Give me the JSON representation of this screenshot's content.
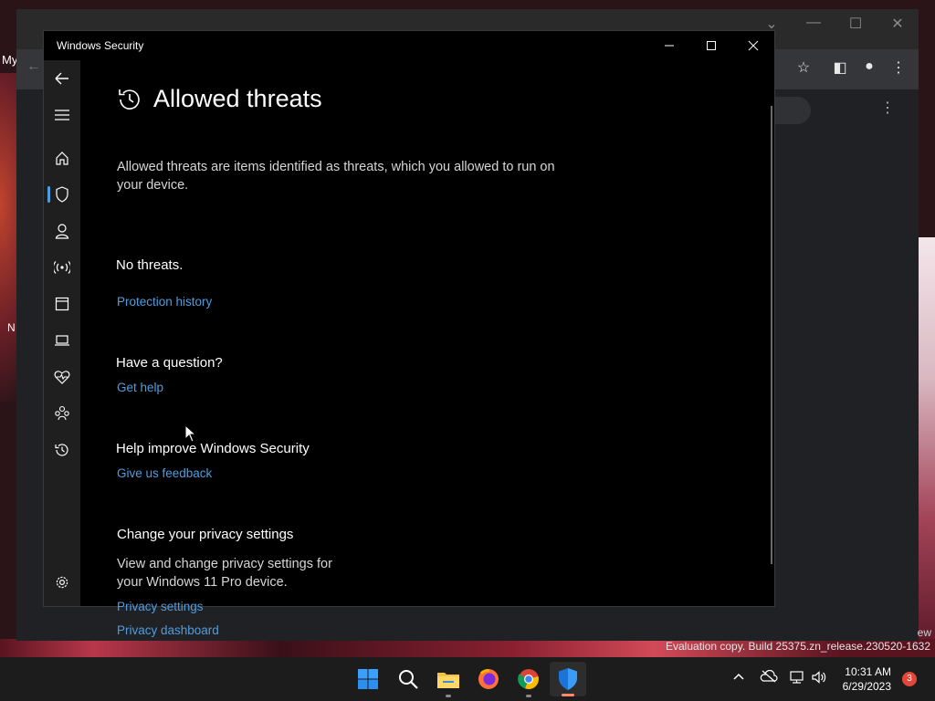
{
  "desktop": {
    "left_text_1": "My",
    "left_text_2": "N",
    "watermark": "Evaluation copy. Build 25375.zn_release.230520-1632",
    "watermark_fragment": "ew"
  },
  "window": {
    "title": "Windows Security"
  },
  "page": {
    "title": "Allowed threats",
    "description": "Allowed threats are items identified as threats, which you allowed to run on your device.",
    "status": "No threats.",
    "protection_history_link": "Protection history"
  },
  "question_section": {
    "heading": "Have a question?",
    "link": "Get help"
  },
  "improve_section": {
    "heading": "Help improve Windows Security",
    "link": "Give us feedback"
  },
  "privacy_section": {
    "heading": "Change your privacy settings",
    "description": "View and change privacy settings for your Windows 11 Pro device.",
    "settings_link": "Privacy settings",
    "dashboard_link": "Privacy dashboard"
  },
  "nav_items": [
    "back-icon",
    "menu-icon",
    "home-icon",
    "shield-icon",
    "account-icon",
    "network-icon",
    "app-browser-icon",
    "device-security-icon",
    "device-health-icon",
    "family-icon",
    "history-icon",
    "settings-icon"
  ],
  "taskbar": {
    "time": "10:31 AM",
    "date": "6/29/2023",
    "notification_count": "3"
  },
  "colors": {
    "accent": "#4f9ddf",
    "window_bg": "#000000",
    "nav_bg": "#1f1f1f",
    "taskbar_bg": "#1c1c1c"
  }
}
